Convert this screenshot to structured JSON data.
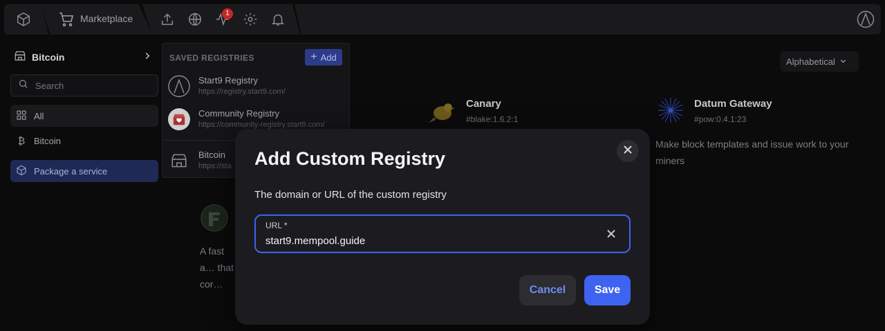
{
  "topbar": {
    "logo_icon": "box-icon",
    "marketplace_label": "Marketplace",
    "icons": [
      "upload-icon",
      "globe-icon",
      "activity-icon",
      "gear-icon",
      "bell-icon"
    ],
    "notification_count": "1",
    "account_icon": "start9-logo-icon"
  },
  "sidebar": {
    "registry_name": "Bitcoin",
    "search_placeholder": "Search",
    "items": [
      {
        "label": "All",
        "icon": "grid-icon"
      },
      {
        "label": "Bitcoin",
        "icon": "bitcoin-icon"
      }
    ],
    "package_label": "Package a service"
  },
  "main": {
    "sort_label": "Alphabetical",
    "services": [
      {
        "title": "Canary",
        "subtitle": "#blake:1.6.2:1",
        "description": ""
      },
      {
        "title": "Datum Gateway",
        "subtitle": "#pow:0.4.1:23",
        "description": "Make block templates and issue work to your miners"
      },
      {
        "title": "",
        "subtitle": "",
        "description": "A fast a… that cor…"
      }
    ]
  },
  "registries": {
    "heading": "SAVED REGISTRIES",
    "add_label": "Add",
    "items": [
      {
        "name": "Start9 Registry",
        "url": "https://registry.start9.com/"
      },
      {
        "name": "Community Registry",
        "url": "https://community-registry.start9.com/"
      },
      {
        "name": "Bitcoin",
        "url": "https://sta"
      }
    ]
  },
  "modal": {
    "title": "Add Custom Registry",
    "description": "The domain or URL of the custom registry",
    "field_label": "URL *",
    "field_value": "start9.mempool.guide",
    "cancel_label": "Cancel",
    "save_label": "Save"
  },
  "colors": {
    "accent": "#3d63f0",
    "background": "#0b0b0c",
    "modal_bg": "#1c1c20"
  }
}
